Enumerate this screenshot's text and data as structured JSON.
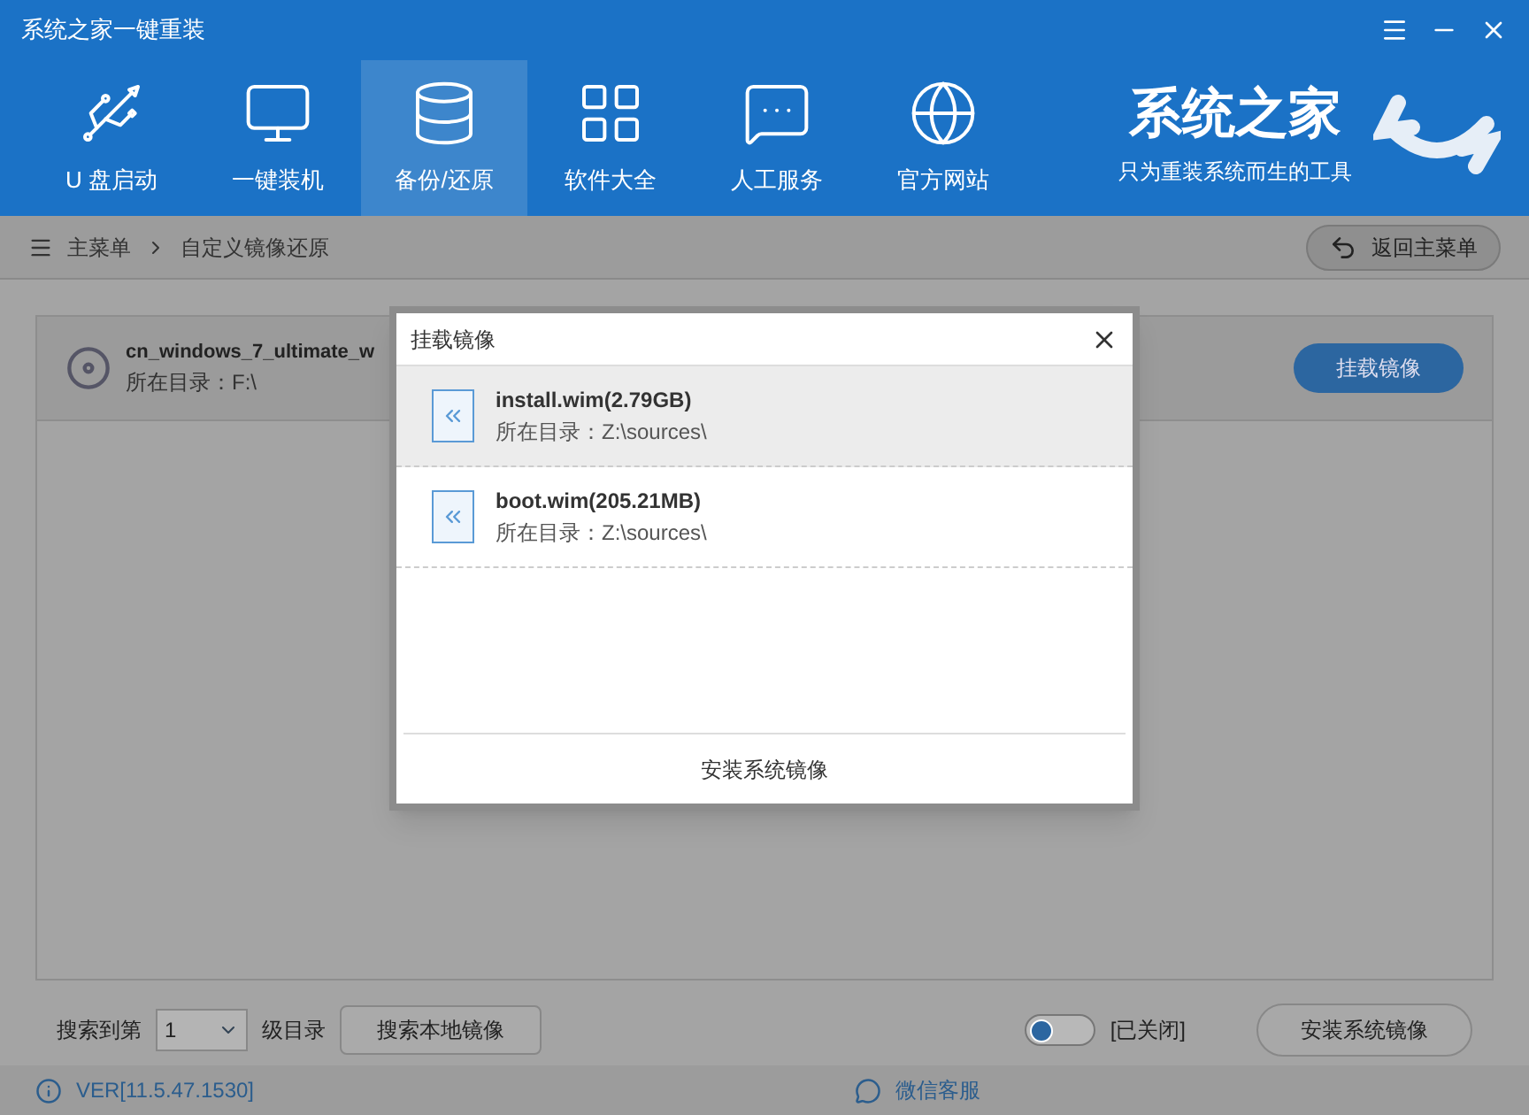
{
  "window": {
    "title": "系统之家一键重装"
  },
  "nav": [
    {
      "label": "U 盘启动",
      "kind": "usb",
      "selected": false
    },
    {
      "label": "一键装机",
      "kind": "monitor",
      "selected": false
    },
    {
      "label": "备份/还原",
      "kind": "database",
      "selected": true
    },
    {
      "label": "软件大全",
      "kind": "apps",
      "selected": false
    },
    {
      "label": "人工服务",
      "kind": "chat",
      "selected": false
    },
    {
      "label": "官方网站",
      "kind": "globe",
      "selected": false
    }
  ],
  "brand": {
    "name": "系统之家",
    "slogan": "只为重装系统而生的工具"
  },
  "breadcrumb": [
    "主菜单",
    "自定义镜像还原"
  ],
  "back_button": "返回主菜单",
  "image_file": {
    "name": "cn_windows_7_ultimate_w",
    "dir": "所在目录：F:\\"
  },
  "mount_button": "挂载镜像",
  "dialog": {
    "title": "挂载镜像",
    "items": [
      {
        "name": "install.wim(2.79GB)",
        "dir": "所在目录：Z:\\sources\\",
        "selected": true
      },
      {
        "name": "boot.wim(205.21MB)",
        "dir": "所在目录：Z:\\sources\\",
        "selected": false
      }
    ],
    "action": "安装系统镜像"
  },
  "footer": {
    "search_label": "搜索到第",
    "depth": "1",
    "depth_suffix": "级目录",
    "search_button": "搜索本地镜像",
    "toggle": {
      "on": false
    },
    "toggle_label": "[已关闭]",
    "install_button": "安装系统镜像"
  },
  "status": {
    "version": "VER[11.5.47.1530]",
    "support": "微信客服"
  }
}
